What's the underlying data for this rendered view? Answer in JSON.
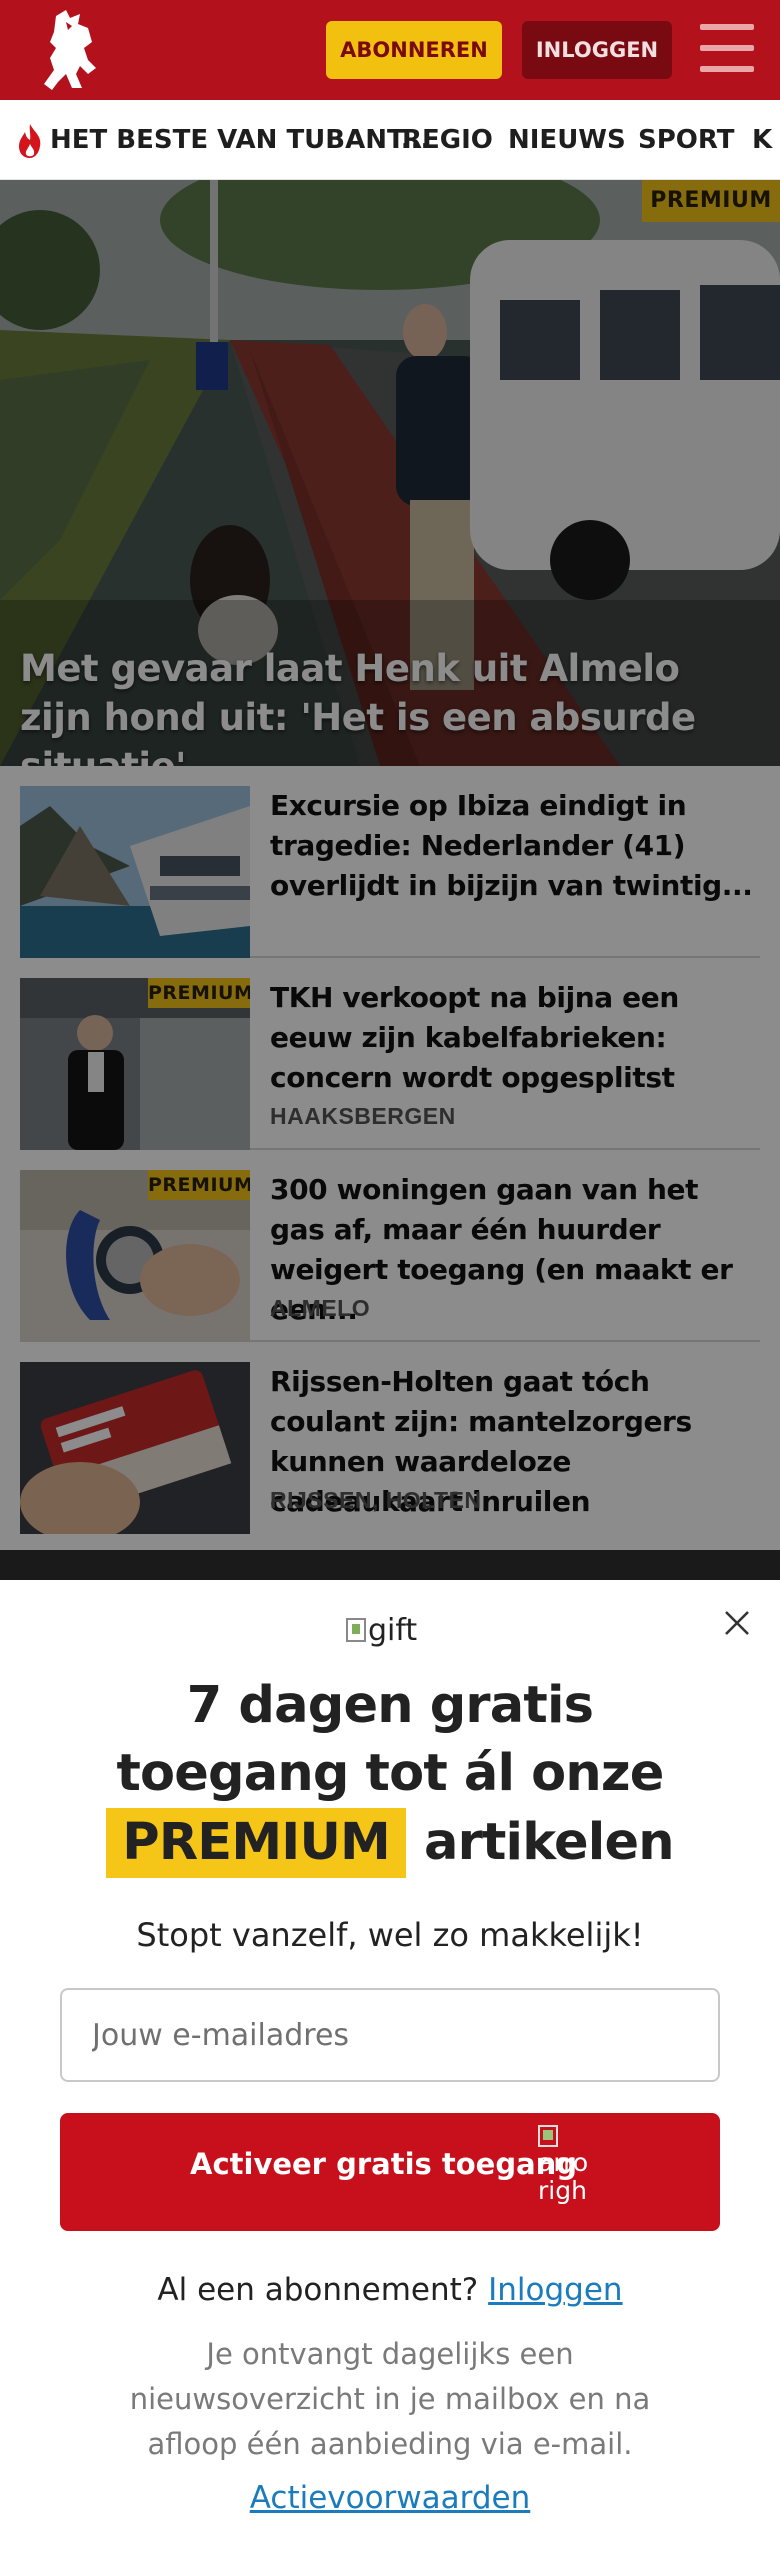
{
  "header": {
    "logo": "tubantia-horse-logo",
    "subscribe_label": "ABONNEREN",
    "login_label": "INLOGGEN",
    "menu_icon": "hamburger-menu-icon"
  },
  "nav": {
    "items": [
      {
        "label": "HET BESTE VAN TUBANT...",
        "icon": "flame-icon"
      },
      {
        "label": "REGIO"
      },
      {
        "label": "NIEUWS"
      },
      {
        "label": "SPORT"
      },
      {
        "label": "K"
      }
    ]
  },
  "hero": {
    "badge": "PREMIUM",
    "title": "Met gevaar laat Henk uit Almelo zijn hond uit: 'Het is een absurde situatie'"
  },
  "articles": [
    {
      "title": "Excursie op Ibiza eindigt in tragedie: Nederlander (41) overlijdt in bijzijn van twintig...",
      "location": "",
      "premium": false
    },
    {
      "title": "TKH verkoopt na bijna een eeuw zijn kabelfabrieken: concern wordt opgesplitst",
      "location": "HAAKSBERGEN",
      "premium": true,
      "badge": "PREMIUM"
    },
    {
      "title": "300 woningen gaan van het gas af, maar één huurder weigert toegang (en maakt er een...",
      "location": "ALMELO",
      "premium": true,
      "badge": "PREMIUM"
    },
    {
      "title": "Rijssen-Holten gaat tóch coulant zijn: mantelzorgers kunnen waardeloze cadeaukaart inruilen",
      "location": "RIJSSEN, HOLTEN",
      "premium": false
    }
  ],
  "modal": {
    "gift_alt": "gift",
    "headline_1": "7 dagen gratis",
    "headline_2": "toegang tot ál onze",
    "headline_premium": "PREMIUM",
    "headline_3": "artikelen",
    "subtitle": "Stopt vanzelf, wel zo makkelijk!",
    "email_placeholder": "Jouw e-mailadres",
    "activate_label": "Activeer gratis toegang",
    "arrow_alt_1": "arro",
    "arrow_alt_2": "righ",
    "already_text": "Al een abonnement?",
    "already_link": "Inloggen",
    "info_text": "Je ontvangt dagelijks een nieuwsoverzicht in je mailbox en na afloop één aanbieding via e-mail.",
    "terms_link": "Actievoorwaarden"
  },
  "colors": {
    "brand_red": "#b3121c",
    "premium_yellow": "#f5c518",
    "link_blue": "#1a7bbd",
    "cta_red": "#c8101c"
  }
}
